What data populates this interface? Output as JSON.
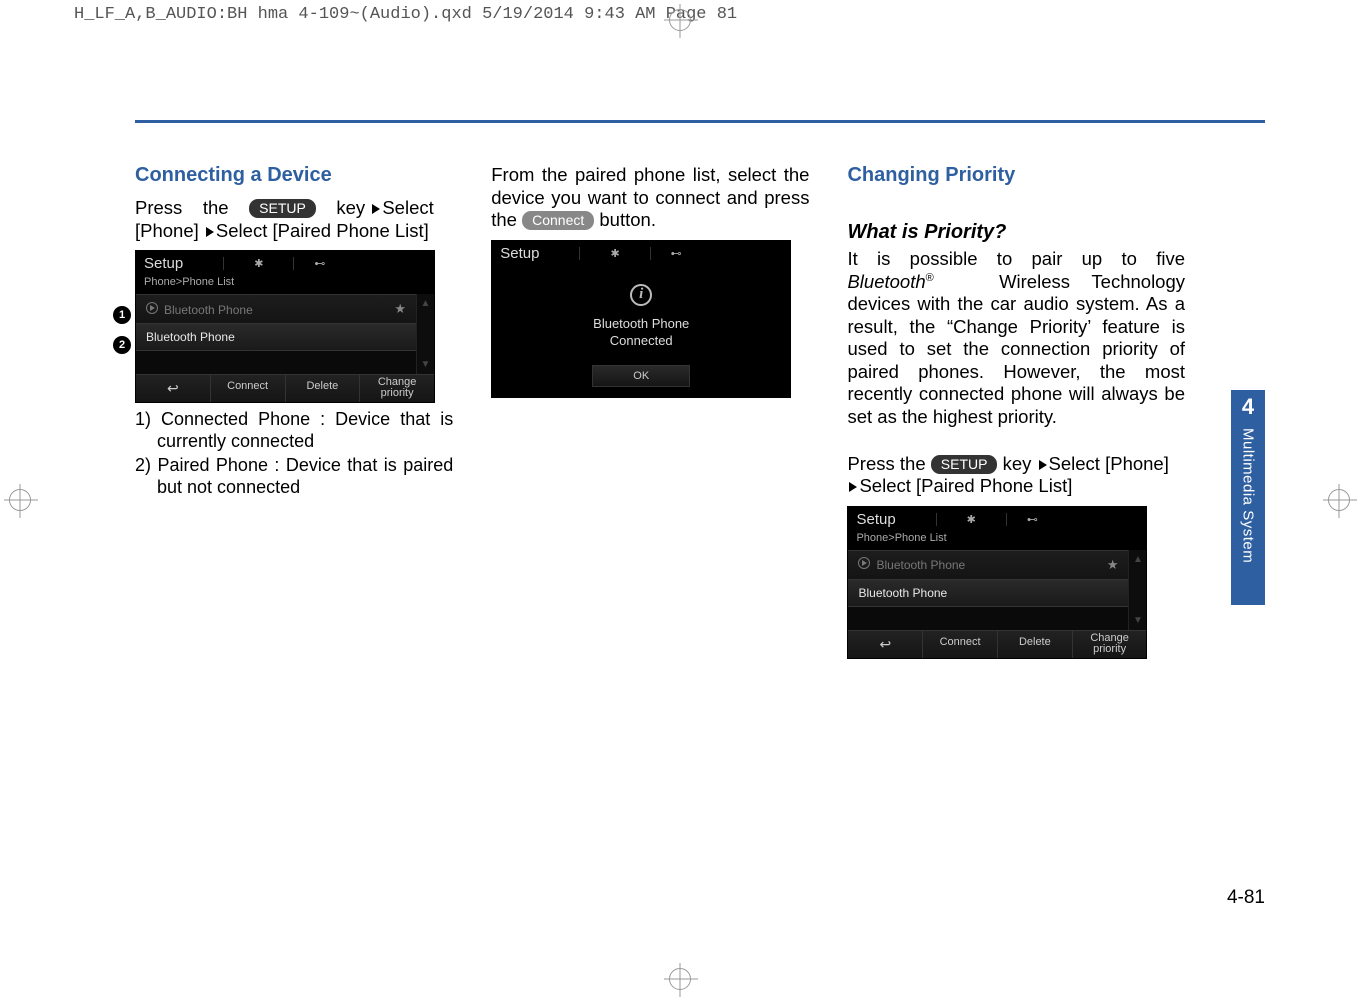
{
  "slug": "H_LF_A,B_AUDIO:BH hma 4-109~(Audio).qxd  5/19/2014  9:43 AM  Page 81",
  "col1": {
    "heading": "Connecting a Device",
    "press_word": "Press",
    "the_word": "the",
    "setup_key": "SETUP",
    "key_word": "key",
    "select_word": "Select",
    "phone_bracket": "[Phone]",
    "paired_bracket": "Select [Paired Phone List]",
    "list1": "1) Connected Phone : Device that is cur­rently connected",
    "list2": "2) Paired Phone : Device that is paired but not connected"
  },
  "col2": {
    "intro1": "From the paired phone list, select the device you want to connect and press the ",
    "connect_btn": "Connect",
    "intro2": " button."
  },
  "col3": {
    "heading": "Changing Priority",
    "sub": "What is Priority?",
    "para1_a": "It is possible to pair up to five ",
    "bt_word": "Bluetooth",
    "reg": "®",
    "para1_b": " Wireless Technology devices with the car audio system. As a result, the “Change Priority’ fea­ture is used to set the connection pri­ority of paired phones. However, the most recently connected phone will always be set as the highest priority.",
    "press_word": "Press the ",
    "setup_key": "SETUP",
    "key_word": " key",
    "select_phone": "Select [Phone]",
    "select_paired": "Select [Paired Phone List]"
  },
  "screenshot_list": {
    "title": "Setup",
    "breadcrumb": "Phone>Phone List",
    "row1": "Bluetooth Phone",
    "row2": "Bluetooth Phone",
    "btn_connect": "Connect",
    "btn_delete": "Delete",
    "btn_change1": "Change",
    "btn_change2": "priority"
  },
  "screenshot_modal": {
    "title": "Setup",
    "line1": "Bluetooth Phone",
    "line2": "Connected",
    "ok": "OK"
  },
  "side": {
    "num": "4",
    "txt": "Multimedia System"
  },
  "page_no": "4-81"
}
